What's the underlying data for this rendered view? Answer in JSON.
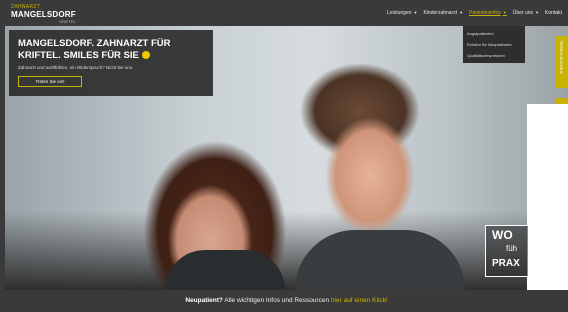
{
  "logo": {
    "small": "ZAHNARZT",
    "name": "MANGELSDORF",
    "tiny": "KRIFTEL"
  },
  "nav": {
    "items": [
      {
        "label": "Leistungen"
      },
      {
        "label": "Kinderzahnarzt"
      },
      {
        "label": "Patienteninfos"
      },
      {
        "label": "Über uns"
      },
      {
        "label": "Kontakt"
      }
    ]
  },
  "dropdown": {
    "items": [
      {
        "label": "Angstpatienten"
      },
      {
        "label": "Extrafor für Neupatienten"
      },
      {
        "label": "Qualitätsversprechen"
      }
    ]
  },
  "hero": {
    "headline": "MANGELSDORF. ZAHNARZT FÜR KRIFTEL. SMILES FÜR SIE",
    "sub": "Zahnarzt und wohlfühlen, ein Widerspruch? Nicht bei uns.",
    "cta": "Treten Sie ein!"
  },
  "side_tag": "TERMIN BUCHEN",
  "promo": {
    "l1": "WO",
    "l2": "füh",
    "l3": "PRAX"
  },
  "bottom": {
    "bold": "Neupatient?",
    "text": " Alle wichtigen Infos und Ressourcen ",
    "link": "hier auf einen Klick!"
  },
  "colors": {
    "accent": "#c8b400",
    "dark": "#3a3a3a"
  }
}
